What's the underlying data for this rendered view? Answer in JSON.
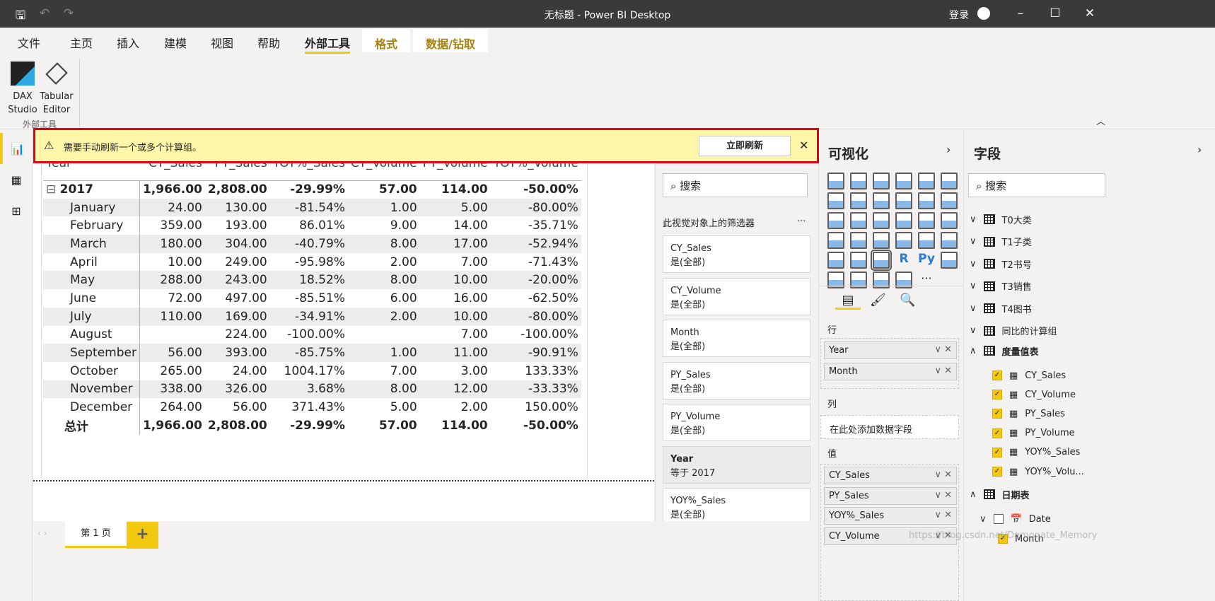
{
  "window": {
    "title": "无标题 - Power BI Desktop",
    "signin": "登录"
  },
  "tabs": [
    "文件",
    "主页",
    "插入",
    "建模",
    "视图",
    "帮助",
    "外部工具"
  ],
  "context_tabs": [
    "格式",
    "数据/钻取"
  ],
  "ribbon": {
    "buttons": [
      {
        "label1": "DAX",
        "label2": "Studio"
      },
      {
        "label1": "Tabular",
        "label2": "Editor"
      }
    ],
    "group": "外部工具"
  },
  "banner": {
    "message": "需要手动刷新一个或多个计算组。",
    "button": "立即刷新"
  },
  "table": {
    "headers": [
      "Year",
      "CY_Sales",
      "PY_Sales",
      "YOY%_Sales",
      "CY_Volume",
      "PY_Volume",
      "YOY%_Volume"
    ],
    "year_row": [
      "2017",
      "1,966.00",
      "2,808.00",
      "-29.99%",
      "57.00",
      "114.00",
      "-50.00%"
    ],
    "rows": [
      [
        "January",
        "24.00",
        "130.00",
        "-81.54%",
        "1.00",
        "5.00",
        "-80.00%"
      ],
      [
        "February",
        "359.00",
        "193.00",
        "86.01%",
        "9.00",
        "14.00",
        "-35.71%"
      ],
      [
        "March",
        "180.00",
        "304.00",
        "-40.79%",
        "8.00",
        "17.00",
        "-52.94%"
      ],
      [
        "April",
        "10.00",
        "249.00",
        "-95.98%",
        "2.00",
        "7.00",
        "-71.43%"
      ],
      [
        "May",
        "288.00",
        "243.00",
        "18.52%",
        "8.00",
        "10.00",
        "-20.00%"
      ],
      [
        "June",
        "72.00",
        "497.00",
        "-85.51%",
        "6.00",
        "16.00",
        "-62.50%"
      ],
      [
        "July",
        "110.00",
        "169.00",
        "-34.91%",
        "2.00",
        "10.00",
        "-80.00%"
      ],
      [
        "August",
        "",
        "224.00",
        "-100.00%",
        "",
        "7.00",
        "-100.00%"
      ],
      [
        "September",
        "56.00",
        "393.00",
        "-85.75%",
        "1.00",
        "11.00",
        "-90.91%"
      ],
      [
        "October",
        "265.00",
        "24.00",
        "1004.17%",
        "7.00",
        "3.00",
        "133.33%"
      ],
      [
        "November",
        "338.00",
        "326.00",
        "3.68%",
        "8.00",
        "12.00",
        "-33.33%"
      ],
      [
        "December",
        "264.00",
        "56.00",
        "371.43%",
        "5.00",
        "2.00",
        "150.00%"
      ]
    ],
    "total_row": [
      "总计",
      "1,966.00",
      "2,808.00",
      "-29.99%",
      "57.00",
      "114.00",
      "-50.00%"
    ]
  },
  "filters": {
    "search": "搜索",
    "section": "此视觉对象上的筛选器",
    "more": "...",
    "cards": [
      {
        "name": "CY_Sales",
        "value": "是(全部)"
      },
      {
        "name": "CY_Volume",
        "value": "是(全部)"
      },
      {
        "name": "Month",
        "value": "是(全部)"
      },
      {
        "name": "PY_Sales",
        "value": "是(全部)"
      },
      {
        "name": "PY_Volume",
        "value": "是(全部)"
      },
      {
        "name": "Year",
        "value": "等于 2017"
      },
      {
        "name": "YOY%_Sales",
        "value": "是(全部)"
      }
    ]
  },
  "viz": {
    "title": "可视化",
    "rows_label": "行",
    "columns_label": "列",
    "columns_placeholder": "在此处添加数据字段",
    "values_label": "值",
    "row_wells": [
      "Year",
      "Month"
    ],
    "value_wells": [
      "CY_Sales",
      "PY_Sales",
      "YOY%_Sales",
      "CY_Volume"
    ],
    "more": "···"
  },
  "fields": {
    "title": "字段",
    "search": "搜索",
    "tables": [
      "T0大类",
      "T1子类",
      "T2书号",
      "T3销售",
      "T4图书",
      "同比的计算组"
    ],
    "measure_table": "度量值表",
    "measures": [
      "CY_Sales",
      "CY_Volume",
      "PY_Sales",
      "PY_Volume",
      "YOY%_Sales",
      "YOY%_Volu..."
    ],
    "date_table": "日期表",
    "date_items": [
      "Date",
      "Month"
    ]
  },
  "pages": {
    "current": "第 1 页",
    "add": "+"
  },
  "watermark": "https://blog.csdn.net/Demonate_Memory",
  "colors": {
    "accent": "#f2c811",
    "warning_bg": "#fdf6a8",
    "highlight_border": "#e0001b"
  }
}
